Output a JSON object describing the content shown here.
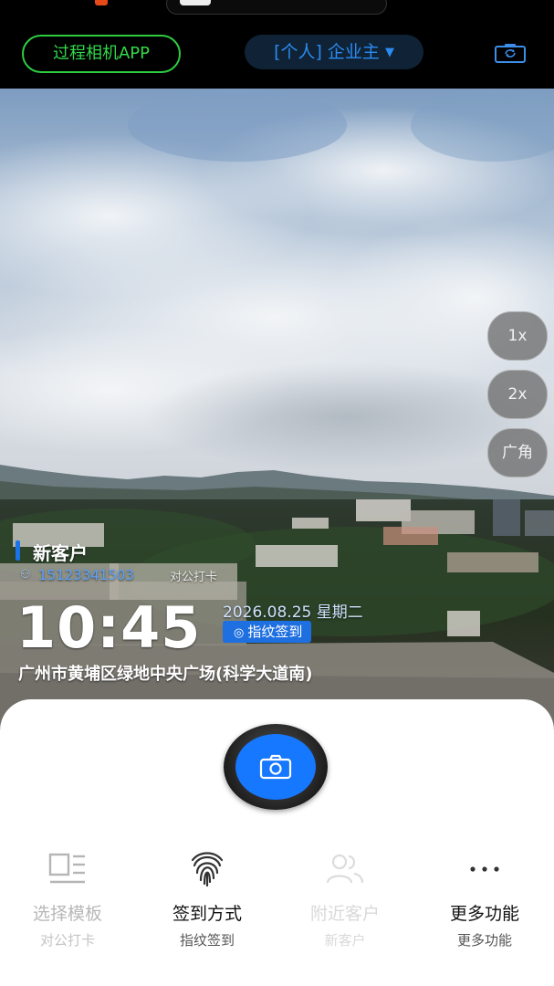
{
  "header": {
    "app_button": "过程相机APP",
    "role_select": "[个人] 企业主",
    "role_caret": "▼"
  },
  "zoom": [
    "1x",
    "2x",
    "广角"
  ],
  "watermark": {
    "customer": "新客户",
    "phone": "15123341503",
    "checkin_label": "对公打卡",
    "time": "10:45",
    "date": "2026.08.25 星期二",
    "badge": "指纹签到",
    "address": "广州市黄埔区绿地中央广场(科学大道南)"
  },
  "tools": [
    {
      "label": "选择模板",
      "sub": "对公打卡",
      "icon": "template-icon"
    },
    {
      "label": "签到方式",
      "sub": "指纹签到",
      "icon": "fingerprint-icon"
    },
    {
      "label": "附近客户",
      "sub": "新客户",
      "icon": "nearby-customers-icon"
    },
    {
      "label": "更多功能",
      "sub": "更多功能",
      "icon": "more-dots-icon"
    }
  ],
  "colors": {
    "accent_green": "#2ecc40",
    "accent_blue": "#1677ff",
    "role_text": "#2b8bf0"
  }
}
